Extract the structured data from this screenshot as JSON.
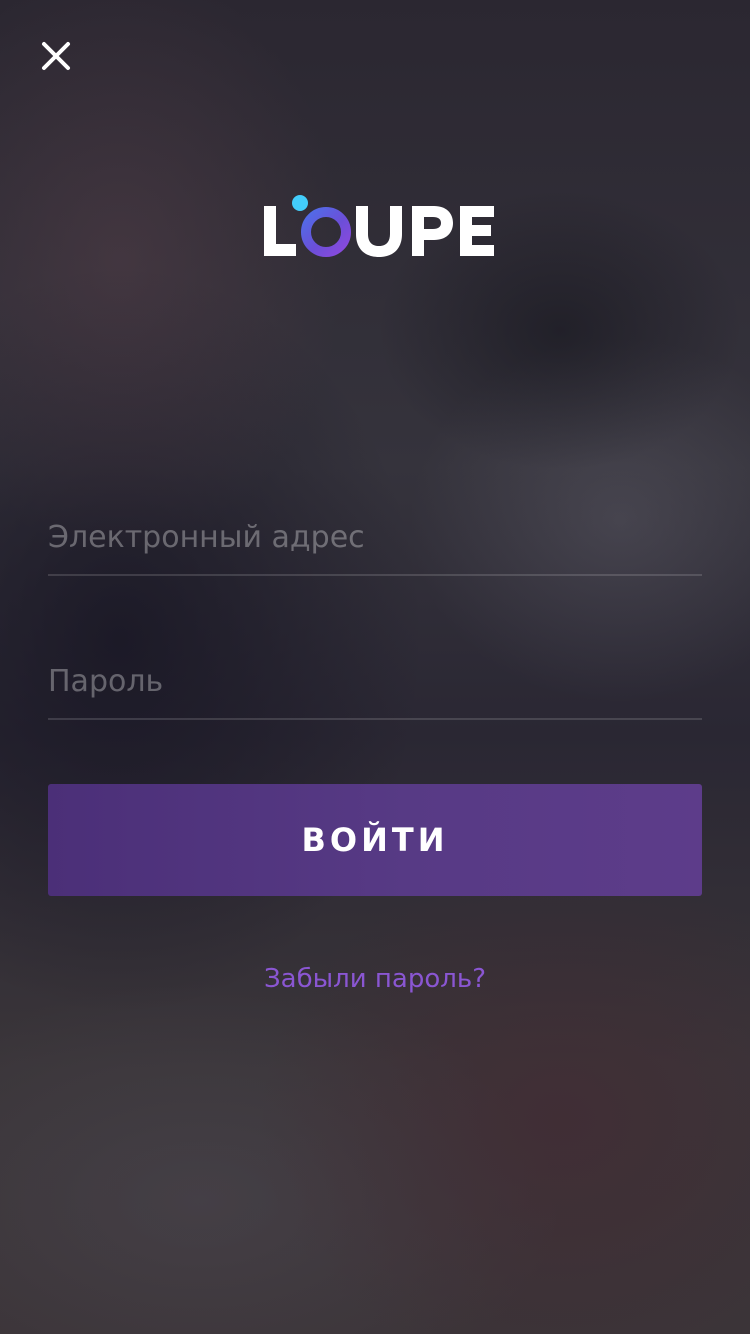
{
  "header": {
    "close_icon": "close-icon"
  },
  "brand": {
    "logo_text": "LOUPE",
    "accent_colors": [
      "#3fd0ff",
      "#6c56d9",
      "#8a4fe0"
    ]
  },
  "form": {
    "email_placeholder": "Электронный адрес",
    "email_value": "",
    "password_placeholder": "Пароль",
    "password_value": "",
    "submit_label": "ВОЙТИ",
    "forgot_link": "Забыли пароль?"
  },
  "colors": {
    "button": "#5a3a86",
    "link": "#8a56d2"
  }
}
